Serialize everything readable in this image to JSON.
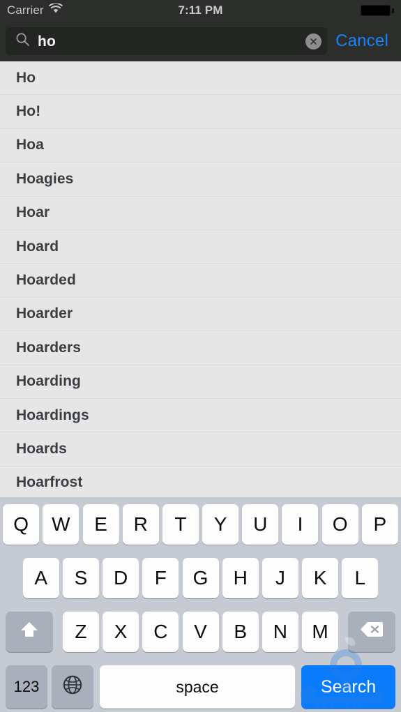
{
  "status_bar": {
    "carrier": "Carrier",
    "time": "7:11 PM",
    "wifi_icon": "wifi-icon",
    "battery_icon": "battery-full-icon"
  },
  "search_bar": {
    "magnifier_icon": "search-icon",
    "value": "ho",
    "placeholder": "Search",
    "clear_icon": "clear-circle-icon",
    "cancel_label": "Cancel",
    "cancel_color": "#1a82fb"
  },
  "suggestions": [
    {
      "label": "Ho"
    },
    {
      "label": "Ho!"
    },
    {
      "label": "Hoa"
    },
    {
      "label": "Hoagies"
    },
    {
      "label": "Hoar"
    },
    {
      "label": "Hoard"
    },
    {
      "label": "Hoarded"
    },
    {
      "label": "Hoarder"
    },
    {
      "label": "Hoarders"
    },
    {
      "label": "Hoarding"
    },
    {
      "label": "Hoardings"
    },
    {
      "label": "Hoards"
    },
    {
      "label": "Hoarfrost"
    }
  ],
  "keyboard": {
    "row1": [
      "Q",
      "W",
      "E",
      "R",
      "T",
      "Y",
      "U",
      "I",
      "O",
      "P"
    ],
    "row2": [
      "A",
      "S",
      "D",
      "F",
      "G",
      "H",
      "J",
      "K",
      "L"
    ],
    "row3": [
      "Z",
      "X",
      "C",
      "V",
      "B",
      "N",
      "M"
    ],
    "shift_icon": "shift-icon",
    "delete_icon": "backspace-icon",
    "numbers_label": "123",
    "globe_icon": "globe-icon",
    "space_label": "space",
    "search_label": "Search",
    "search_key_color": "#0a7bfb",
    "background_color": "#c6cbd3",
    "key_color": "#fdfdfd",
    "function_key_color": "#a9b0bb"
  },
  "watermark": {
    "name": "site-watermark-logo"
  }
}
